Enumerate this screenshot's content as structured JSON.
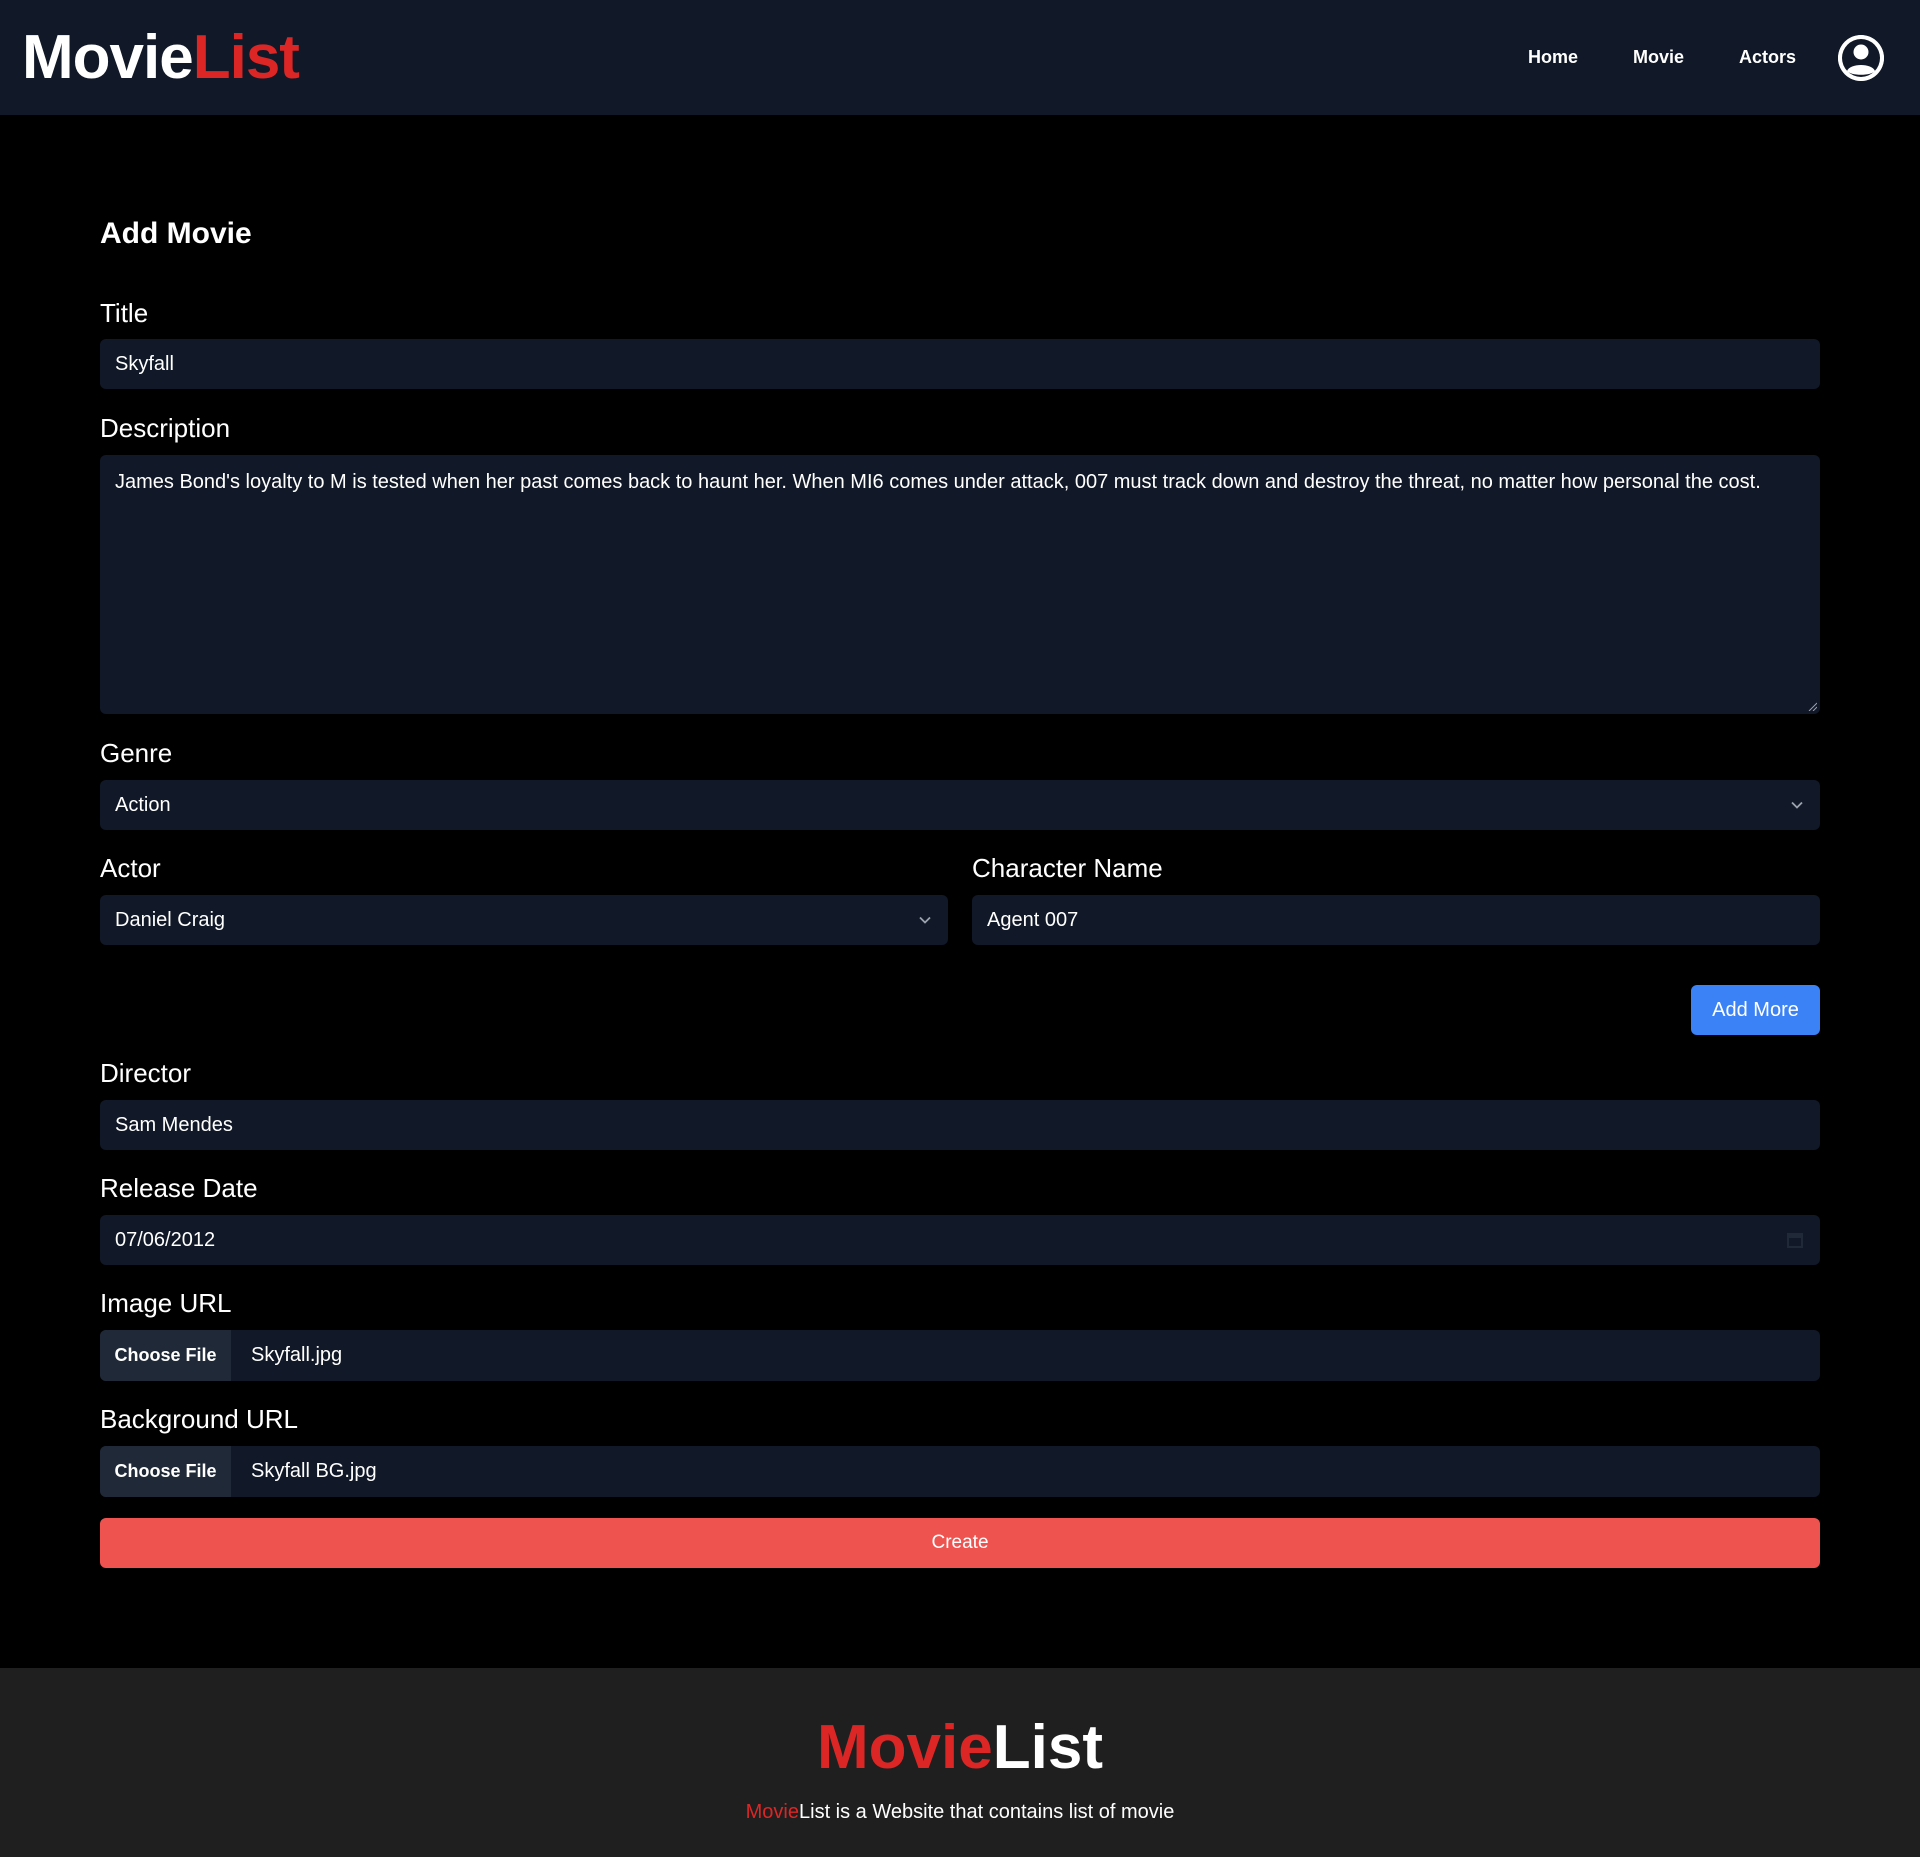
{
  "header": {
    "brand_part1": "Movie",
    "brand_part2": "List",
    "nav": [
      "Home",
      "Movie",
      "Actors"
    ],
    "profile_icon": "user-circle-icon"
  },
  "form": {
    "heading": "Add Movie",
    "title": {
      "label": "Title",
      "value": "Skyfall"
    },
    "description": {
      "label": "Description",
      "value": "James Bond's loyalty to M is tested when her past comes back to haunt her. When MI6 comes under attack, 007 must track down and destroy the threat, no matter how personal the cost."
    },
    "genre": {
      "label": "Genre",
      "value": "Action"
    },
    "actor": {
      "label": "Actor",
      "value": "Daniel Craig"
    },
    "character": {
      "label": "Character Name",
      "value": "Agent 007"
    },
    "add_more_label": "Add More",
    "director": {
      "label": "Director",
      "value": "Sam Mendes"
    },
    "release_date": {
      "label": "Release Date",
      "value": "07/06/2012"
    },
    "image_url": {
      "label": "Image URL",
      "button": "Choose File",
      "file": "Skyfall.jpg"
    },
    "background_url": {
      "label": "Background URL",
      "button": "Choose File",
      "file": "Skyfall BG.jpg"
    },
    "create_label": "Create"
  },
  "footer": {
    "brand_part1": "Movie",
    "brand_part2": "List",
    "tagline_part1": "Movie",
    "tagline_part2": "List is a Website that contains list of movie"
  },
  "colors": {
    "navbar_bg": "#111827",
    "field_bg": "#111827",
    "brand_red": "#dc2626",
    "add_more_blue": "#3b82f6",
    "create_red": "#ef5350",
    "footer_bg": "#1f1f1f"
  }
}
